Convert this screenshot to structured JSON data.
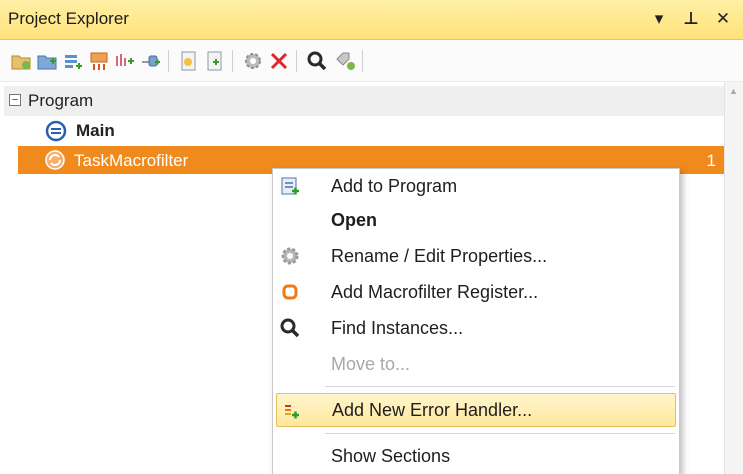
{
  "panel": {
    "title": "Project Explorer",
    "buttons": {
      "dropdown": "▾",
      "pin": "⊥",
      "close": "✕"
    }
  },
  "toolbar": {
    "icons": [
      "new-folder-icon",
      "add-folder-icon",
      "add-list-icon",
      "add-worker-icon",
      "add-connection-icon",
      "add-step-icon",
      "copy-page-icon",
      "paste-page-icon",
      "properties-gear-icon",
      "delete-icon",
      "search-icon",
      "tag-icon"
    ]
  },
  "tree": {
    "program": {
      "label": "Program",
      "expander": "−"
    },
    "main": {
      "label": "Main"
    },
    "task": {
      "label": "TaskMacrofilter",
      "count": "1"
    }
  },
  "menu": {
    "items": [
      {
        "label": "Add to Program",
        "icon": "add-to-program-icon"
      },
      {
        "label": "Open"
      },
      {
        "label": "Rename / Edit Properties...",
        "icon": "gear-icon"
      },
      {
        "label": "Add Macrofilter Register...",
        "icon": "register-icon"
      },
      {
        "label": "Find Instances...",
        "icon": "search-icon"
      },
      {
        "label": "Move to..."
      },
      {
        "label": "Add New Error Handler...",
        "icon": "error-handler-icon"
      },
      {
        "label": "Show Sections"
      }
    ]
  },
  "colors": {
    "titlebar": "#ffe27a",
    "selection": "#f08a1c",
    "menu_highlight": "#ffe79b"
  }
}
